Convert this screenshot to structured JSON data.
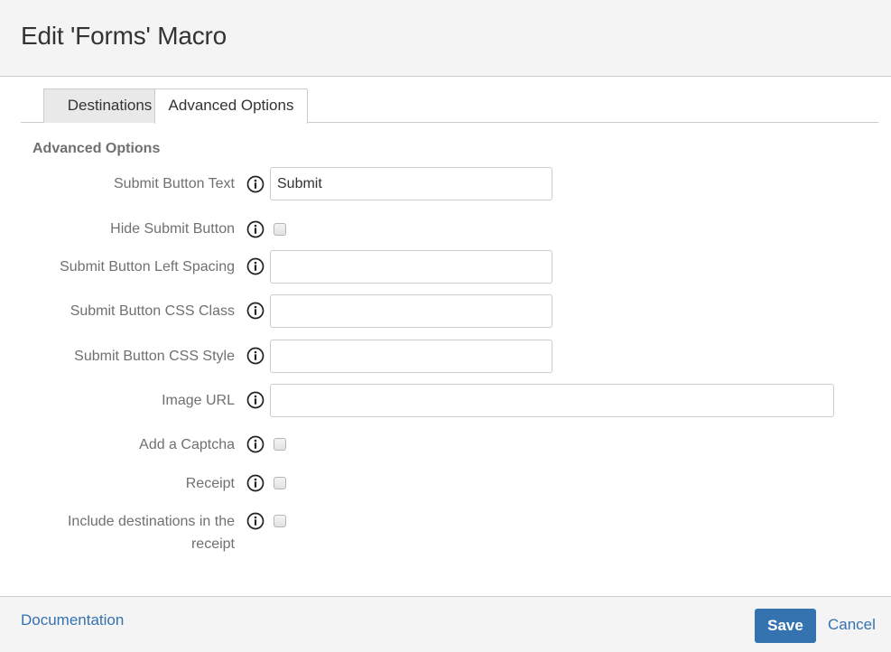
{
  "dialog": {
    "title": "Edit 'Forms' Macro"
  },
  "tabs": [
    {
      "label": "Destinations",
      "active": false
    },
    {
      "label": "Advanced Options",
      "active": true
    }
  ],
  "section": {
    "title": "Advanced Options"
  },
  "fields": {
    "submit_button_text": {
      "label": "Submit Button Text",
      "type": "text",
      "value": "Submit",
      "icon": "info-icon"
    },
    "hide_submit_button": {
      "label": "Hide Submit Button",
      "type": "checkbox",
      "checked": false,
      "icon": "info-icon"
    },
    "submit_button_left_spacing": {
      "label": "Submit Button Left Spacing",
      "type": "text",
      "value": "",
      "icon": "info-icon"
    },
    "submit_button_css_class": {
      "label": "Submit Button CSS Class",
      "type": "text",
      "value": "",
      "icon": "info-icon"
    },
    "submit_button_css_style": {
      "label": "Submit Button CSS Style",
      "type": "text",
      "value": "",
      "icon": "info-icon"
    },
    "image_url": {
      "label": "Image URL",
      "type": "text",
      "value": "",
      "icon": "info-icon"
    },
    "add_captcha": {
      "label": "Add a Captcha",
      "type": "checkbox",
      "checked": false,
      "icon": "info-icon"
    },
    "receipt": {
      "label": "Receipt",
      "type": "checkbox",
      "checked": false,
      "icon": "info-icon"
    },
    "include_destinations": {
      "label_line1": "Include destinations in the",
      "label_line2": "receipt",
      "type": "checkbox",
      "checked": false,
      "icon": "info-icon"
    }
  },
  "footer": {
    "documentation_label": "Documentation",
    "save_label": "Save",
    "cancel_label": "Cancel"
  },
  "colors": {
    "primary": "#3572b0",
    "header_bg": "#f4f4f4",
    "label_text": "#707070",
    "border": "#cccccc"
  }
}
